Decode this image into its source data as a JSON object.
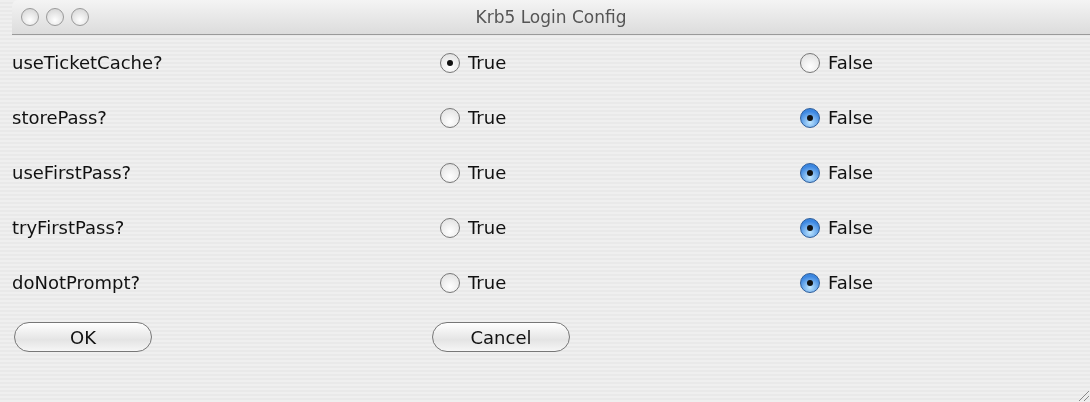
{
  "window": {
    "title": "Krb5 Login Config"
  },
  "options": [
    {
      "name": "useTicketCache?",
      "kind": "plain",
      "choices": [
        {
          "label": "True",
          "selected": true
        },
        {
          "label": "False",
          "selected": false
        }
      ]
    },
    {
      "name": "storePass?",
      "kind": "aqua",
      "choices": [
        {
          "label": "True",
          "selected": false
        },
        {
          "label": "False",
          "selected": true
        }
      ]
    },
    {
      "name": "useFirstPass?",
      "kind": "aqua",
      "choices": [
        {
          "label": "True",
          "selected": false
        },
        {
          "label": "False",
          "selected": true
        }
      ]
    },
    {
      "name": "tryFirstPass?",
      "kind": "aqua",
      "choices": [
        {
          "label": "True",
          "selected": false
        },
        {
          "label": "False",
          "selected": true
        }
      ]
    },
    {
      "name": "doNotPrompt?",
      "kind": "aqua",
      "choices": [
        {
          "label": "True",
          "selected": false
        },
        {
          "label": "False",
          "selected": true
        }
      ]
    }
  ],
  "buttons": [
    "OK",
    "Cancel"
  ]
}
